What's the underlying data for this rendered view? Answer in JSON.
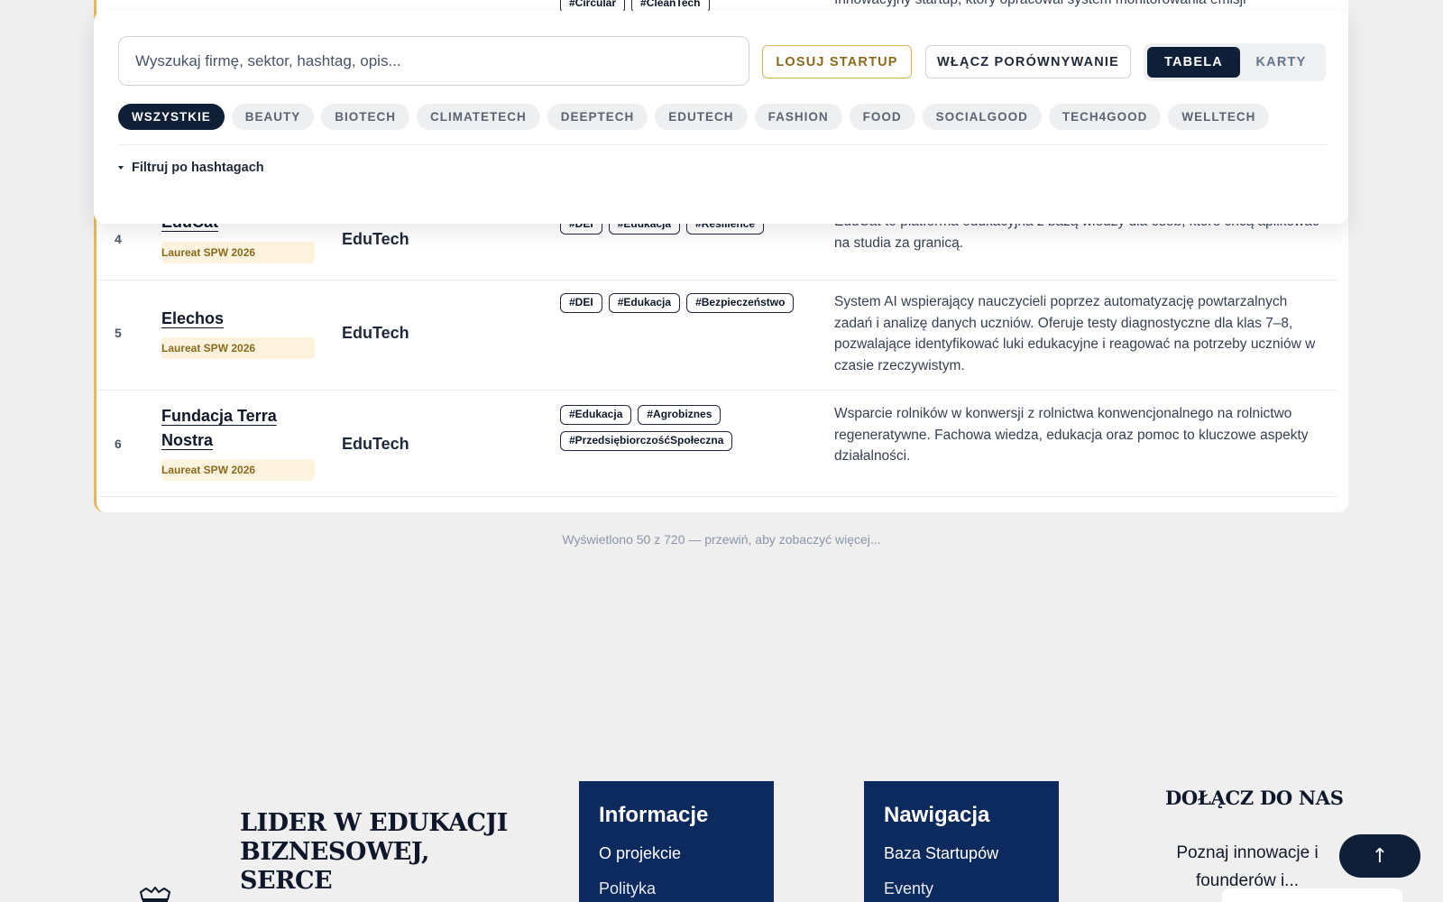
{
  "filters": {
    "search_placeholder": "Wyszukaj firmę, sektor, hashtag, opis...",
    "random_label": "LOSUJ STARTUP",
    "compare_label": "WŁĄCZ PORÓWNYWANIE",
    "view_table_label": "TABELA",
    "view_cards_label": "KARTY",
    "sectors": [
      "WSZYSTKIE",
      "BEAUTY",
      "BIOTECH",
      "CLIMATETECH",
      "DEEPTECH",
      "EDUTECH",
      "FASHION",
      "FOOD",
      "SOCIALGOOD",
      "TECH4GOOD",
      "WELLTECH"
    ],
    "active_sector": "WSZYSTKIE",
    "hashtag_filter_label": "Filtruj po hashtagach"
  },
  "table": {
    "partial_row": {
      "tags": [
        "#Circular",
        "#CleanTech"
      ],
      "description": "Innowacyjny startup, który opracował system monitorowania emisji"
    },
    "rows": [
      {
        "num": "4",
        "name": "EduCat",
        "badge": "Laureat SPW 2026",
        "sector": "EduTech",
        "tags": [
          "#DEI",
          "#Edukacja",
          "#Resilience"
        ],
        "description": "EduCat to platforma edukacyjna z bazą wiedzy dla osób, które chcą aplikować na studia za granicą."
      },
      {
        "num": "5",
        "name": "Elechos",
        "badge": "Laureat SPW 2026",
        "sector": "EduTech",
        "tags": [
          "#DEI",
          "#Edukacja",
          "#Bezpieczeństwo"
        ],
        "description": "System AI wspierający nauczycieli poprzez automatyzację powtarzalnych zadań i analizę danych uczniów. Oferuje testy diagnostyczne dla klas 7–8, pozwalające identyfikować luki edukacyjne i reagować na potrzeby uczniów w czasie rzeczywistym."
      },
      {
        "num": "6",
        "name": "Fundacja Terra Nostra",
        "badge": "Laureat SPW 2026",
        "sector": "EduTech",
        "tags": [
          "#Edukacja",
          "#Agrobiznes",
          "#PrzedsiębiorczośćSpołeczna"
        ],
        "description": "Wsparcie rolników w konwersji z rolnictwa konwencjonalnego na rolnictwo regeneratywne. Fachowa wiedza, edukacja oraz pomoc to kluczowe aspekty działalności."
      }
    ],
    "status": "Wyświetlono 50 z 720 — przewiń, aby zobaczyć więcej..."
  },
  "footer": {
    "headline": "LIDER W EDUKACJI BIZNESOWEJ, SERCE",
    "info_box": {
      "title": "Informacje",
      "link1": "O projekcie",
      "link2": "Polityka"
    },
    "nav_box": {
      "title": "Nawigacja",
      "link1": "Baza Startupów",
      "link2": "Eventy"
    },
    "join_title": "DOŁĄCZ DO NAS",
    "join_text": "Poznaj innowacje i founderów i..."
  },
  "scroll_top_icon": "arrow-up-icon",
  "colors": {
    "navy": "#0f1f38",
    "footer_navy": "#0d2a5e",
    "accent_gold": "#e8b85c",
    "badge_bg": "#fdf3df"
  }
}
